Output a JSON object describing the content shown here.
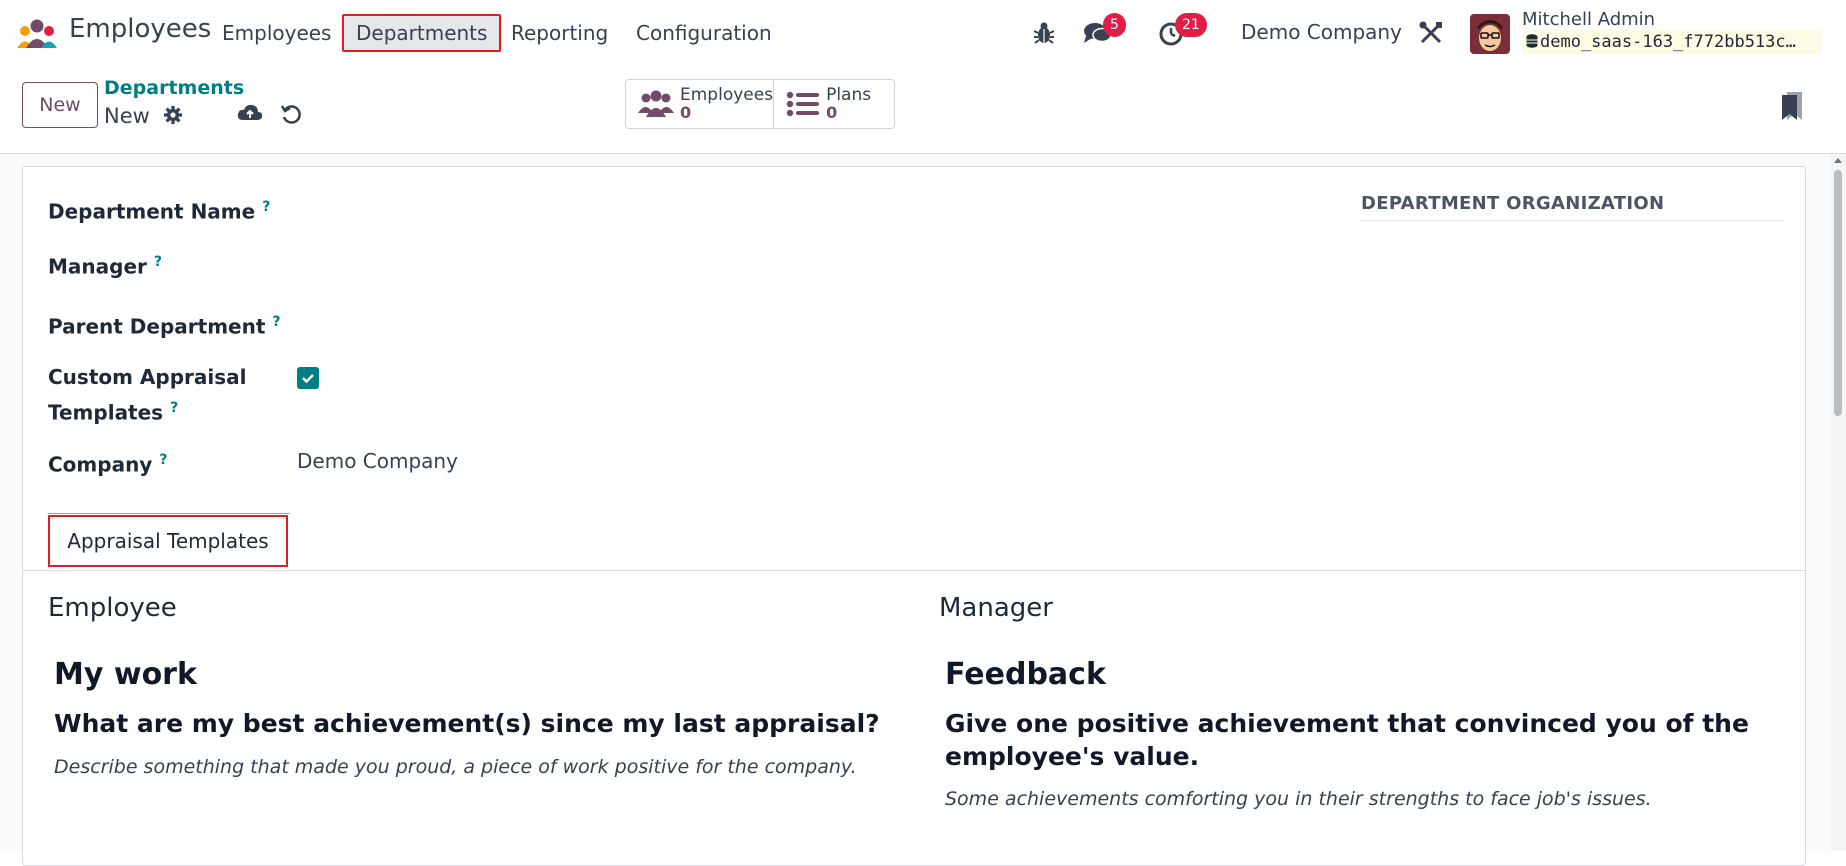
{
  "navbar": {
    "app_name": "Employees",
    "menu": [
      "Employees",
      "Departments",
      "Reporting",
      "Configuration"
    ],
    "messages_badge": "5",
    "activities_badge": "21",
    "company": "Demo Company",
    "user_name": "Mitchell Admin",
    "database": "demo_saas-163_f772bb513c…"
  },
  "control_panel": {
    "new_label": "New",
    "breadcrumb_parent": "Departments",
    "breadcrumb_current": "New",
    "smart_buttons": [
      {
        "label": "Employees",
        "count": "0"
      },
      {
        "label": "Plans",
        "count": "0"
      }
    ]
  },
  "form": {
    "labels": {
      "department_name": "Department Name",
      "manager": "Manager",
      "parent_department": "Parent Department",
      "custom_appraisal_line1": "Custom Appraisal",
      "custom_appraisal_line2": "Templates",
      "company": "Company"
    },
    "help_mark": "?",
    "company_value": "Demo Company",
    "custom_appraisal_checked": true,
    "section_title": "DEPARTMENT ORGANIZATION",
    "tab_label": "Appraisal Templates"
  },
  "templates": {
    "employee": {
      "heading": "Employee",
      "title": "My work",
      "question": "What are my best achievement(s) since my last appraisal?",
      "description": "Describe something that made you proud, a piece of work positive for the company."
    },
    "manager": {
      "heading": "Manager",
      "title": "Feedback",
      "question_line1": "Give one positive achievement that convinced you of the",
      "question_line2": "employee's value.",
      "description": "Some achievements comforting you in their strengths to face job's issues."
    }
  },
  "colors": {
    "brand_purple": "#714b67",
    "teal": "#017e84",
    "badge_red": "#e11d48",
    "highlight_red": "#e11d28"
  }
}
